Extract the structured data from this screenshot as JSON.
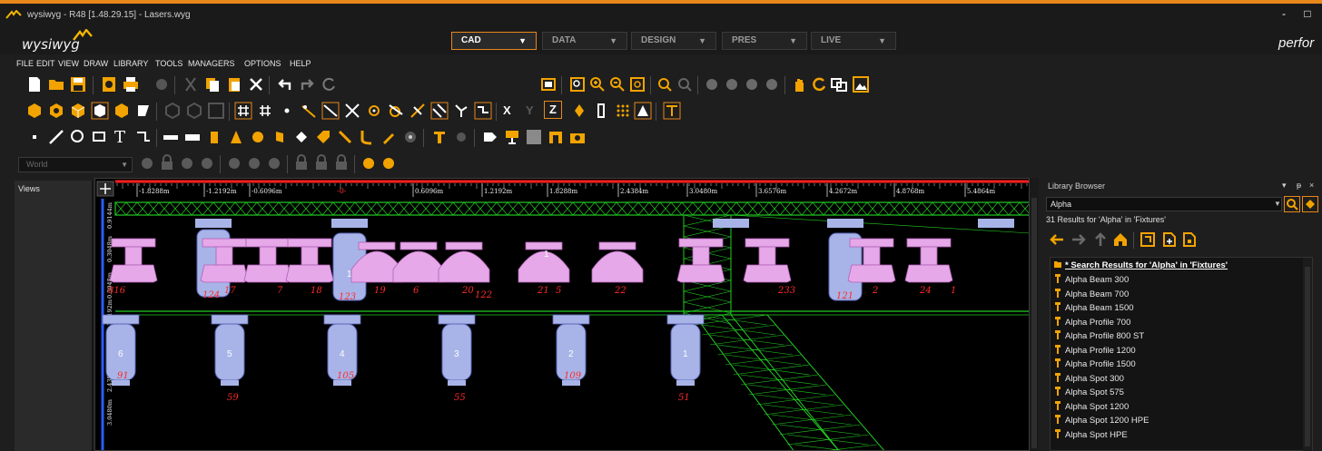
{
  "window": {
    "title": "wysiwyg - R48 [1.48.29.15] - Lasers.wyg",
    "minimize_label": "-",
    "maximize_label": "□"
  },
  "brand": {
    "logo_text": "wysiwyg",
    "right_text": "perfor"
  },
  "mode_tabs": [
    {
      "label": "CAD",
      "active": true
    },
    {
      "label": "DATA",
      "active": false
    },
    {
      "label": "DESIGN",
      "active": false
    },
    {
      "label": "PRES",
      "active": false
    },
    {
      "label": "LIVE",
      "active": false
    }
  ],
  "menu": [
    "FILE",
    "EDIT",
    "VIEW",
    "DRAW",
    "LIBRARY",
    "TOOLS",
    "MANAGERS",
    "OPTIONS",
    "HELP"
  ],
  "toolbar": {
    "world_combo": "World",
    "axis_labels": [
      "X",
      "Y",
      "Z"
    ]
  },
  "views_panel": {
    "label": "Views"
  },
  "cad_view": {
    "ruler_labels": [
      "-1.8288m",
      "-1.2192m",
      "-0.6096m",
      "0.6096m",
      "1.2192m",
      "1.8288m",
      "2.4384m",
      "3.0480m",
      "3.6576m",
      "4.2672m",
      "4.8768m",
      "5.4864m"
    ],
    "ruler_zero": "-0-",
    "left_ruler_labels": [
      "0.9144m",
      "0.3048m",
      "0.3048m",
      "1.2192m",
      "1.8288m",
      "2.4384m",
      "3.0480m"
    ],
    "top_row_numbers": [
      "816",
      "124",
      "17",
      "7",
      "18",
      "123",
      "19",
      "6",
      "20",
      "122",
      "21",
      "5",
      "22",
      "233",
      "121",
      "2",
      "24",
      "1"
    ],
    "top_row_inner_labels": [
      "1",
      "1"
    ],
    "bottom_row_inner_labels": [
      "6",
      "5",
      "4",
      "3",
      "2",
      "1"
    ],
    "bottom_row_numbers": [
      "91",
      "59",
      "105",
      "55",
      "109",
      "51"
    ]
  },
  "library": {
    "title": "Library Browser",
    "pin_label": "▾",
    "float_label": "ᵽ",
    "close_label": "×",
    "search_value": "Alpha",
    "results_text": "31 Results for 'Alpha' in 'Fixtures'",
    "list_header": "* Search Results for 'Alpha' in 'Fixtures'",
    "items": [
      "Alpha Beam 300",
      "Alpha Beam 700",
      "Alpha Beam 1500",
      "Alpha Profile 700",
      "Alpha Profile 800 ST",
      "Alpha Profile 1200",
      "Alpha Profile 1500",
      "Alpha Spot 300",
      "Alpha Spot 575",
      "Alpha Spot 1200",
      "Alpha Spot 1200 HPE",
      "Alpha Spot HPE"
    ]
  },
  "colors": {
    "accent": "#e8871a",
    "fixture_pink": "#e6a8e8",
    "fixture_blue": "#a8b4e8",
    "truss_green": "#22cc22",
    "ruler_red": "#ff2020",
    "label_red": "#ff2a2a"
  }
}
